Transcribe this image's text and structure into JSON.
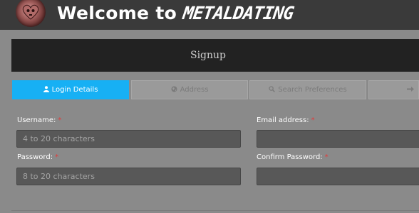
{
  "header": {
    "welcome_text": "Welcome to",
    "brand_text": "METALDATING",
    "logo_icon": "heart-skull-icon"
  },
  "signup": {
    "title": "Signup"
  },
  "steps": [
    {
      "label": "Login Details",
      "icon": "user-icon",
      "active": true
    },
    {
      "label": "Address",
      "icon": "globe-icon",
      "active": false
    },
    {
      "label": "Search Preferences",
      "icon": "search-icon",
      "active": false
    },
    {
      "label": "",
      "icon": "arrow-right-icon",
      "active": false
    }
  ],
  "form": {
    "username": {
      "label": "Username:",
      "required": "*",
      "placeholder": "4 to 20 characters"
    },
    "email": {
      "label": "Email address:",
      "required": "*",
      "placeholder": ""
    },
    "password": {
      "label": "Password:",
      "required": "*",
      "placeholder": "8 to 20 characters"
    },
    "confirm_password": {
      "label": "Confirm Password:",
      "required": "*",
      "placeholder": ""
    }
  },
  "colors": {
    "active_step": "#17b0f4",
    "required_mark": "#e23b3b",
    "header_bg": "#3a3a3a",
    "page_bg": "#8a8a8a"
  }
}
